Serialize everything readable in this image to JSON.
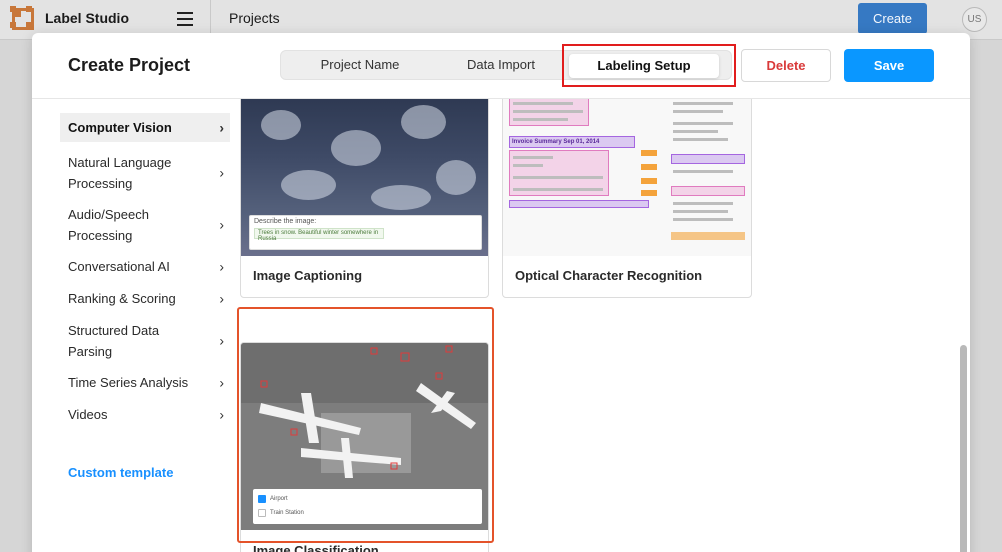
{
  "app": {
    "title": "Label Studio",
    "page": "Projects",
    "create_label": "Create",
    "avatar_initials": "US"
  },
  "modal": {
    "title": "Create Project",
    "tabs": [
      {
        "label": "Project Name"
      },
      {
        "label": "Data Import"
      },
      {
        "label": "Labeling Setup"
      }
    ],
    "delete_label": "Delete",
    "save_label": "Save"
  },
  "sidebar": {
    "categories": [
      {
        "label": "Computer Vision"
      },
      {
        "label": "Natural Language Processing"
      },
      {
        "label": "Audio/Speech Processing"
      },
      {
        "label": "Conversational AI"
      },
      {
        "label": "Ranking & Scoring"
      },
      {
        "label": "Structured Data Parsing"
      },
      {
        "label": "Time Series Analysis"
      },
      {
        "label": "Videos"
      }
    ],
    "custom_template": "Custom template"
  },
  "templates": [
    {
      "title": "Image Captioning",
      "preview_prompt": "Describe the image:",
      "preview_answer": "Trees in snow. Beautiful winter somewhere in Russia"
    },
    {
      "title": "Optical Character Recognition",
      "preview_heading": "Invoice Summary Sep 01, 2014"
    },
    {
      "title": "Image Classification",
      "choices": [
        "Airport",
        "Train Station"
      ]
    }
  ],
  "colors": {
    "accent": "#1890ff",
    "danger": "#d93a3a",
    "highlight": "#e11d1d",
    "create": "#3679c3"
  }
}
